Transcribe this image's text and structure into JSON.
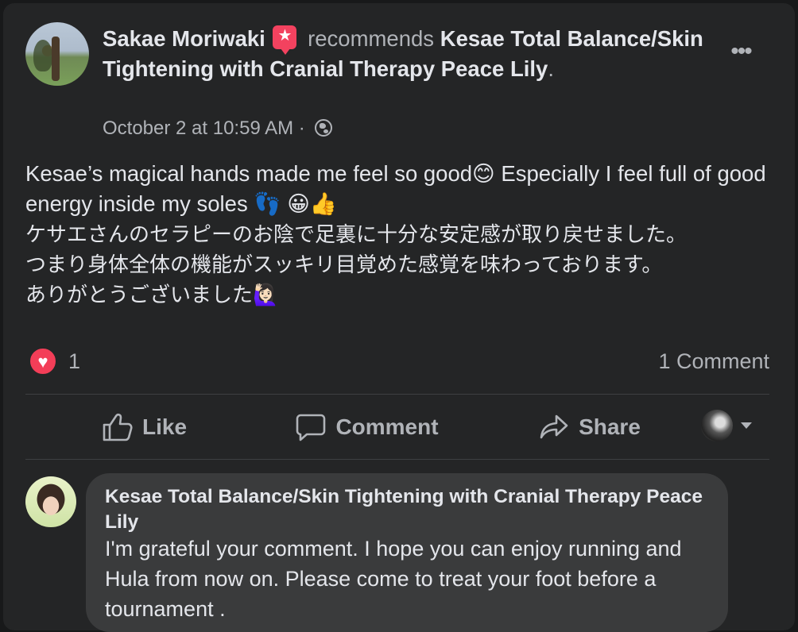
{
  "post": {
    "author": "Sakae Moriwaki",
    "verb": "recommends",
    "page_name": "Kesae Total Balance/Skin Tightening with Cranial Therapy Peace Lily",
    "period": ".",
    "timestamp": "October 2 at 10:59 AM",
    "separator": " · ",
    "privacy_icon": "globe-icon",
    "more_label": "•••",
    "body_line1": "Kesae’s magical hands made me feel so good😊 Especially I feel full of good energy inside my soles 👣 😀👍",
    "body_ja1": "ケサエさんのセラピーのお陰で足裏に十分な安定感が取り戻せました。",
    "body_ja2": "つまり身体全体の機能がスッキリ目覚めた感覚を味わっております。",
    "body_ja3": "ありがとうございました🙋🏻‍♀️"
  },
  "stats": {
    "reaction_icon": "heart-icon",
    "reaction_count": "1",
    "comments_label": "1 Comment"
  },
  "actions": {
    "like": "Like",
    "comment": "Comment",
    "share": "Share"
  },
  "comment": {
    "author": "Kesae Total Balance/Skin Tightening with Cranial Therapy Peace Lily",
    "text": "I'm grateful your comment. I hope you can enjoy running and Hula from now on. Please come to treat your foot before a tournament ."
  },
  "colors": {
    "background": "#18191a",
    "card": "#242526",
    "text_primary": "#e4e6eb",
    "text_secondary": "#b0b3b8",
    "recommend_badge": "#f3425f",
    "love_reaction": "#f33e58",
    "comment_bubble": "#3a3b3c"
  }
}
